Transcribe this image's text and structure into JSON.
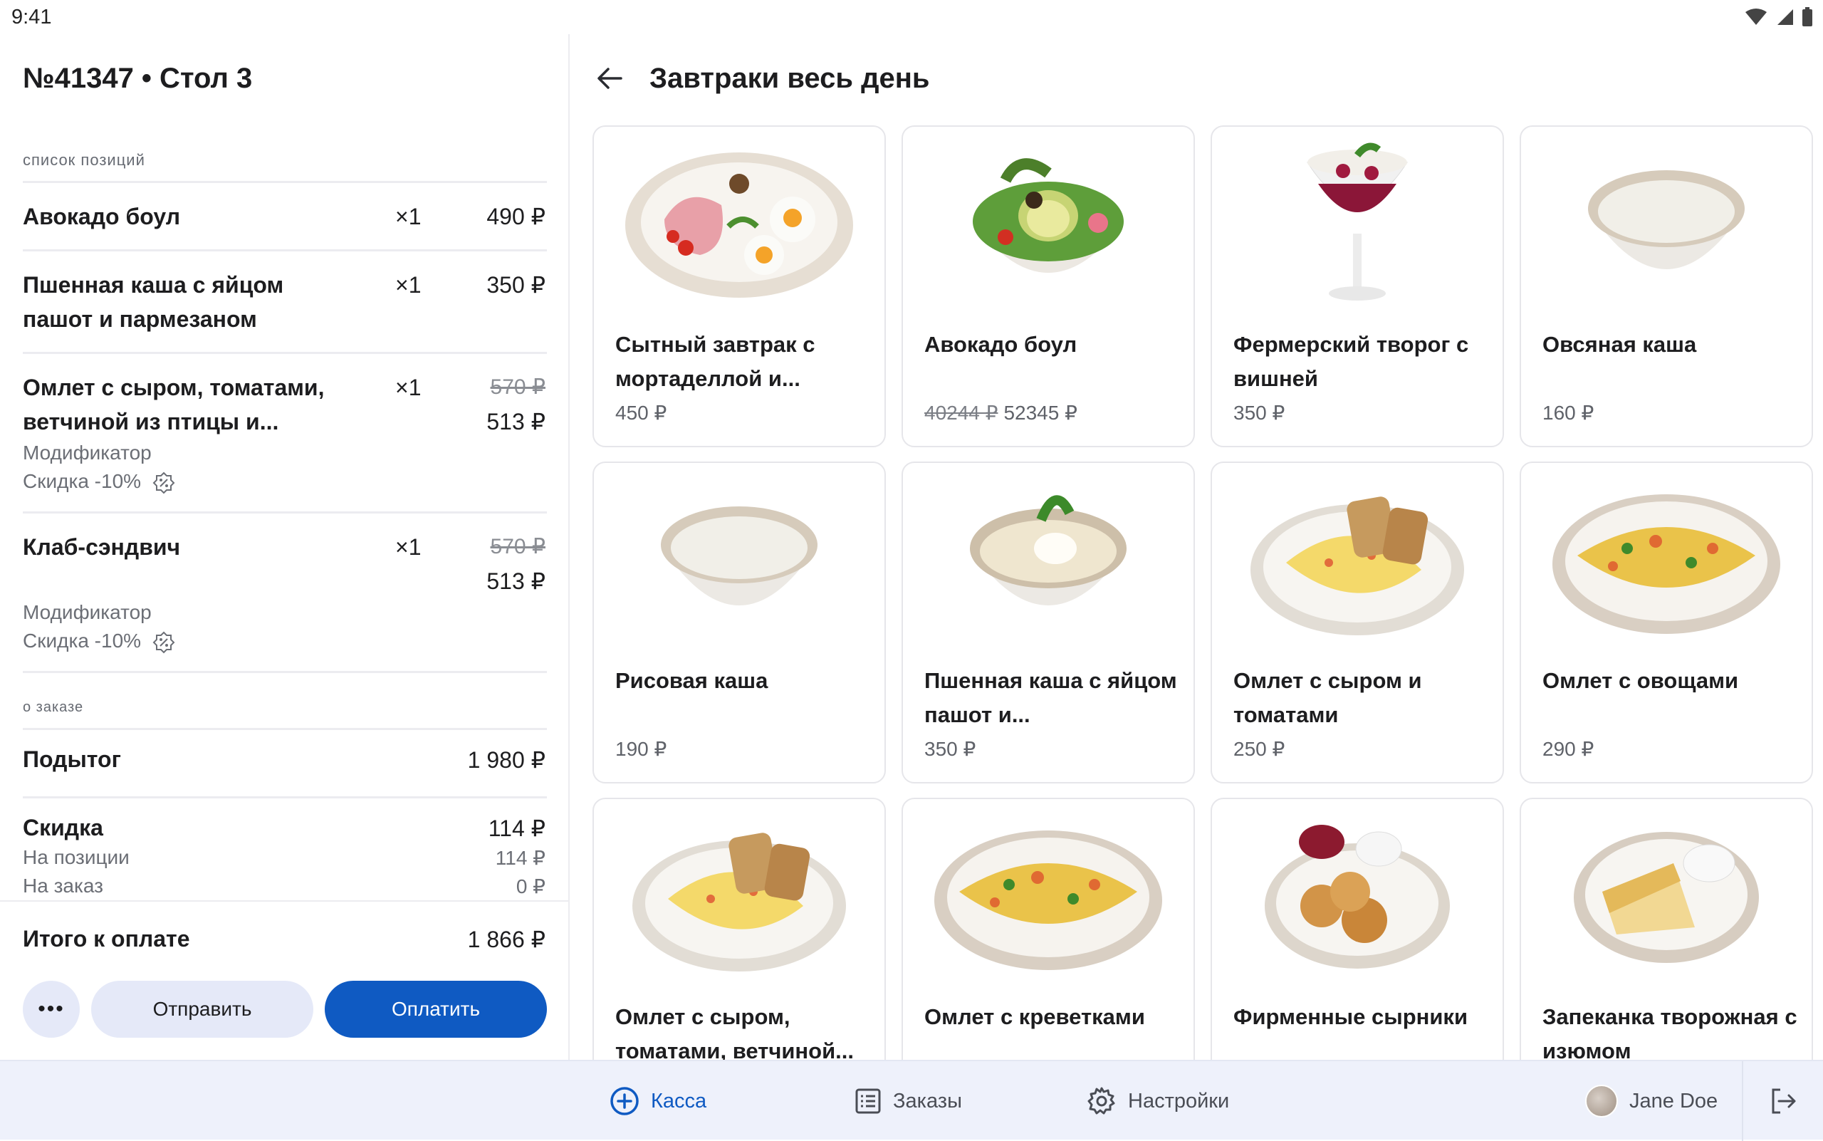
{
  "status": {
    "time": "9:41"
  },
  "order": {
    "title": "№41347 • Стол 3",
    "items_label": "список позиций",
    "items": [
      {
        "name": "Авокадо боул",
        "qty": "×1",
        "price": "490 ₽"
      },
      {
        "name": "Пшенная каша с яйцом пашот и пармезаном",
        "qty": "×1",
        "price": "350 ₽"
      },
      {
        "name": "Омлет с сыром, томатами, ветчиной из птицы и...",
        "qty": "×1",
        "old_price": "570 ₽",
        "price": "513 ₽",
        "modifier": "Модификатор",
        "discount": "Скидка -10%"
      },
      {
        "name": "Клаб-сэндвич",
        "qty": "×1",
        "old_price": "570 ₽",
        "price": "513 ₽",
        "modifier": "Модификатор",
        "discount": "Скидка -10%"
      }
    ],
    "about_label": "о заказе",
    "subtotal_label": "Подытог",
    "subtotal": "1 980 ₽",
    "discount_label": "Скидка",
    "discount_total": "114 ₽",
    "discount_items_label": "На позиции",
    "discount_items": "114 ₽",
    "discount_order_label": "На заказ",
    "discount_order": "0 ₽",
    "total_label": "Итого к оплате",
    "total": "1 866 ₽",
    "more_label": "•••",
    "send_label": "Отправить",
    "pay_label": "Оплатить"
  },
  "menu": {
    "title": "Завтраки весь день",
    "cards": [
      {
        "name": "Сытный завтрак с мортаделлой и...",
        "price": "450 ₽",
        "img": "plate-breakfast"
      },
      {
        "name": "Авокадо боул",
        "old_price": "40244 ₽",
        "price": "52345 ₽",
        "img": "bowl-avocado"
      },
      {
        "name": "Фермерский творог с вишней",
        "price": "350 ₽",
        "img": "glass-dessert"
      },
      {
        "name": "Овсяная каша",
        "price": "160 ₽",
        "img": "bowl-porridge"
      },
      {
        "name": "Рисовая каша",
        "price": "190 ₽",
        "img": "bowl-porridge"
      },
      {
        "name": "Пшенная каша с яйцом пашот и...",
        "price": "350 ₽",
        "img": "bowl-egg"
      },
      {
        "name": "Омлет с сыром и томатами",
        "price": "250 ₽",
        "img": "plate-omelet-bread"
      },
      {
        "name": "Омлет с овощами",
        "price": "290 ₽",
        "img": "plate-omelet"
      },
      {
        "name": "Омлет с сыром, томатами, ветчиной...",
        "price": "",
        "img": "plate-omelet-bread"
      },
      {
        "name": "Омлет с креветками",
        "price": "",
        "img": "plate-omelet"
      },
      {
        "name": "Фирменные сырники",
        "price": "",
        "img": "plate-syrniki"
      },
      {
        "name": "Запеканка творожная с изюмом",
        "price": "",
        "img": "plate-casserole"
      }
    ]
  },
  "nav": {
    "kassa": "Касса",
    "orders": "Заказы",
    "settings": "Настройки",
    "user": "Jane Doe"
  },
  "colors": {
    "accent": "#0f5ac2",
    "nav_bg": "#eef1fb",
    "secondary_btn": "#e5e9f8"
  }
}
